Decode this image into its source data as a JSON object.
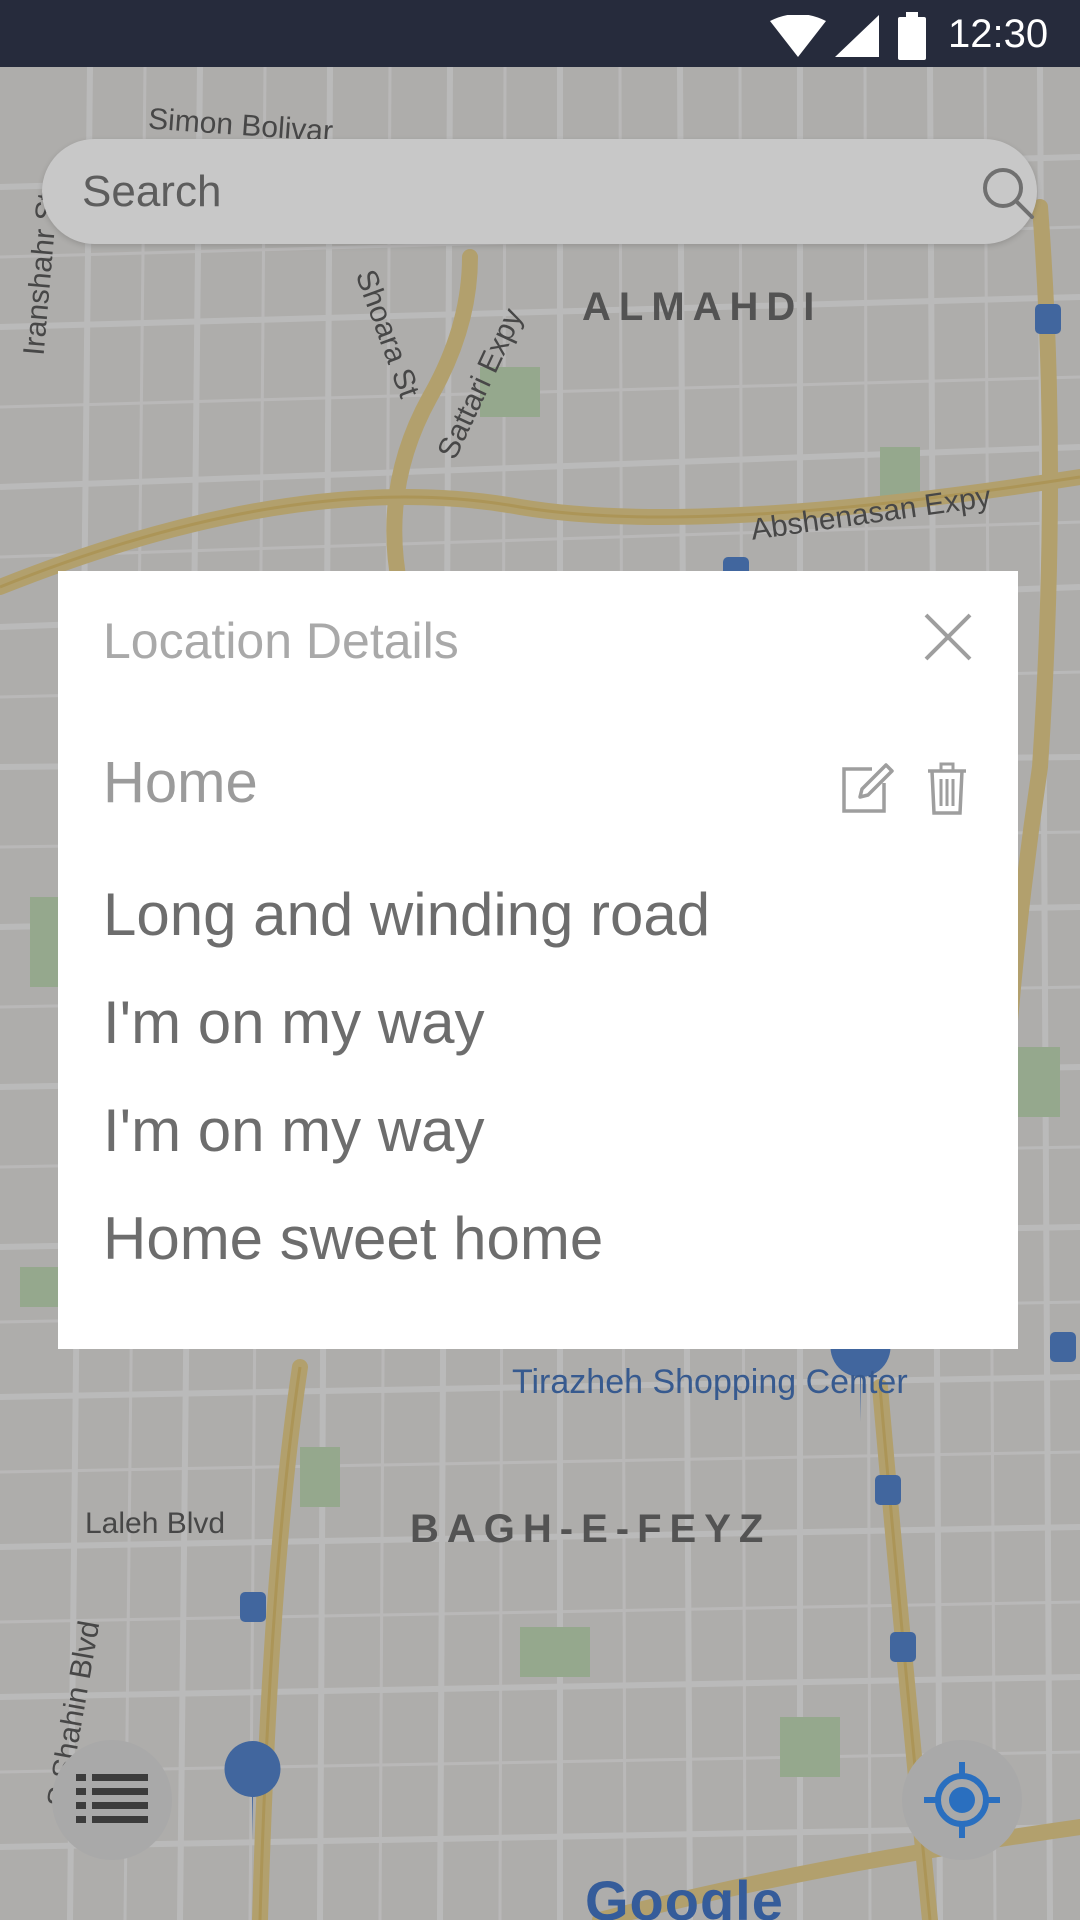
{
  "status_bar": {
    "time": "12:30",
    "icons": [
      "wifi-icon",
      "signal-icon",
      "battery-icon"
    ]
  },
  "search": {
    "placeholder": "Search",
    "icon": "search-icon"
  },
  "map": {
    "districts": [
      "ALMAHDI",
      "BAGH-E-FEYZ"
    ],
    "roads": [
      "Abshenasan Expy",
      "Sattari Expy",
      "Shoara St",
      "Laleh Blvd",
      "S Shahin Blvd",
      "Iranshahr St",
      "Simon Bolivar"
    ],
    "pois": [
      "Tirazheh Shopping Center"
    ],
    "attribution": "Google"
  },
  "dialog": {
    "title": "Location Details",
    "location_name": "Home",
    "details": [
      "Long and winding road",
      "I'm on my way",
      "I'm on my way",
      "Home sweet home"
    ],
    "actions": [
      "close-icon",
      "edit-icon",
      "trash-icon"
    ]
  },
  "colors": {
    "status_bar": "#262b3c",
    "dim_overlay": "rgba(90,90,90,0.42)",
    "dialog_bg": "#ffffff",
    "title_text": "#a9a9a9",
    "body_text": "#6d6d6d",
    "locate_accent": "#2a6fbf"
  }
}
